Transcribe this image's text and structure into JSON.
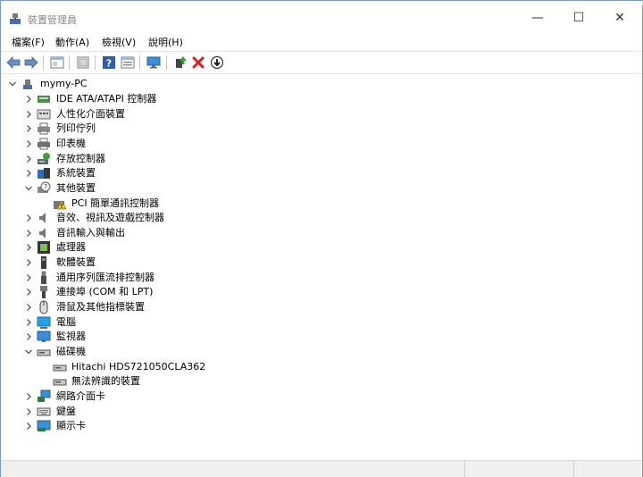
{
  "window": {
    "title": "裝置管理員",
    "controls": {
      "minimize": "—",
      "maximize": "☐",
      "close": "✕"
    }
  },
  "menu": [
    {
      "label": "檔案(F)"
    },
    {
      "label": "動作(A)"
    },
    {
      "label": "檢視(V)"
    },
    {
      "label": "說明(H)"
    }
  ],
  "toolbar": [
    "back-icon",
    "forward-icon",
    "properties-pane-icon",
    "computer-view-icon",
    "help-icon",
    "details-icon",
    "monitor-icon",
    "update-driver-icon",
    "uninstall-icon",
    "disable-icon"
  ],
  "tree": {
    "root": "mymy-PC",
    "categories": [
      {
        "label": "IDE ATA/ATAPI 控制器",
        "icon": "ide-icon",
        "expanded": false
      },
      {
        "label": "人性化介面裝置",
        "icon": "hid-icon",
        "expanded": false
      },
      {
        "label": "列印佇列",
        "icon": "print-queue-icon",
        "expanded": false
      },
      {
        "label": "印表機",
        "icon": "printer-icon",
        "expanded": false
      },
      {
        "label": "存放控制器",
        "icon": "storage-controller-icon",
        "expanded": false
      },
      {
        "label": "系統裝置",
        "icon": "system-devices-icon",
        "expanded": false
      },
      {
        "label": "其他裝置",
        "icon": "other-devices-icon",
        "expanded": true,
        "children": [
          {
            "label": "PCI 簡單通訊控制器",
            "icon": "warning-device-icon"
          }
        ]
      },
      {
        "label": "音效、視訊及遊戲控制器",
        "icon": "sound-icon",
        "expanded": false
      },
      {
        "label": "音訊輸入與輸出",
        "icon": "audio-io-icon",
        "expanded": false
      },
      {
        "label": "處理器",
        "icon": "processor-icon",
        "expanded": false
      },
      {
        "label": "軟體裝置",
        "icon": "software-device-icon",
        "expanded": false
      },
      {
        "label": "通用序列匯流排控制器",
        "icon": "usb-icon",
        "expanded": false
      },
      {
        "label": "連接埠 (COM 和 LPT)",
        "icon": "port-icon",
        "expanded": false
      },
      {
        "label": "滑鼠及其他指標裝置",
        "icon": "mouse-icon",
        "expanded": false
      },
      {
        "label": "電腦",
        "icon": "computer-icon",
        "expanded": false
      },
      {
        "label": "監視器",
        "icon": "monitor-icon",
        "expanded": false
      },
      {
        "label": "磁碟機",
        "icon": "disk-drive-icon",
        "expanded": true,
        "children": [
          {
            "label": "Hitachi HDS721050CLA362",
            "icon": "disk-icon"
          },
          {
            "label": "無法辨識的裝置",
            "icon": "disk-icon"
          }
        ]
      },
      {
        "label": "網路介面卡",
        "icon": "network-adapter-icon",
        "expanded": false
      },
      {
        "label": "鍵盤",
        "icon": "keyboard-icon",
        "expanded": false
      },
      {
        "label": "顯示卡",
        "icon": "display-adapter-icon",
        "expanded": false
      }
    ]
  }
}
